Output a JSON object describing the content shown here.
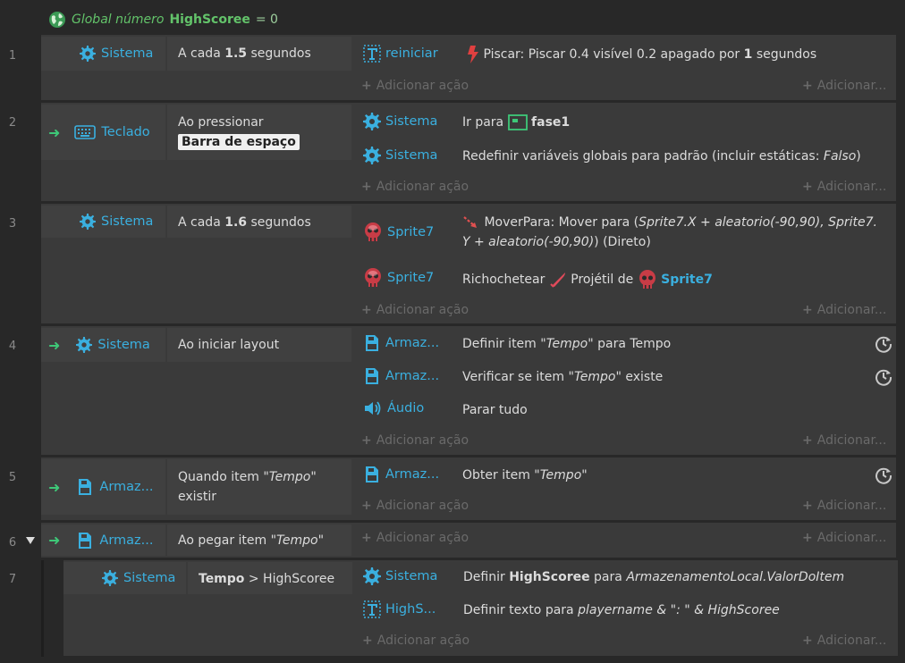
{
  "global_var": {
    "prefix": "Global número",
    "name": "HighScoree",
    "value": "= 0"
  },
  "row_numbers": [
    "1",
    "2",
    "3",
    "4",
    "5",
    "6",
    "7"
  ],
  "events": {
    "e1": {
      "cond_obj": "Sistema",
      "cond_text_a": "A cada",
      "cond_text_b": "1.5",
      "cond_text_c": "segundos",
      "actions": [
        {
          "obj": "reiniciar",
          "text_a": "Piscar: Piscar 0.4 visível 0.2 apagado por",
          "text_b": "1",
          "text_c": "segundos"
        }
      ]
    },
    "e2": {
      "cond_obj": "Teclado",
      "cond_text_a": "Ao pressionar",
      "cond_chip": "Barra de espaço",
      "actions": [
        {
          "obj": "Sistema",
          "text_a": "Ir para",
          "text_b": "fase1"
        },
        {
          "obj": "Sistema",
          "text_a": "Redefinir variáveis globais para padrão (incluir estáticas:",
          "text_b": "Falso",
          "text_c": ")"
        }
      ]
    },
    "e3": {
      "cond_obj": "Sistema",
      "cond_text_a": "A cada",
      "cond_text_b": "1.6",
      "cond_text_c": "segundos",
      "actions": [
        {
          "obj": "Sprite7",
          "text_a": "MoverPara: Mover para (",
          "text_b": "Sprite7.X + aleatorio(-90,90), Sprite7.",
          "text_c": "Y + aleatorio(-90,90)",
          "text_d": ") (Direto)"
        },
        {
          "obj": "Sprite7",
          "text_a": "Richochetear",
          "text_b": "Projétil de",
          "text_c": "Sprite7"
        }
      ]
    },
    "e4": {
      "cond_obj": "Sistema",
      "cond_text_a": "Ao iniciar layout",
      "actions": [
        {
          "obj": "Armaz...",
          "text_a": "Definir item \"",
          "text_b": "Tempo",
          "text_c": "\" para Tempo"
        },
        {
          "obj": "Armaz...",
          "text_a": "Verificar se item \"",
          "text_b": "Tempo",
          "text_c": "\" existe"
        },
        {
          "obj": "Áudio",
          "text_a": "Parar tudo"
        }
      ]
    },
    "e5": {
      "cond_obj": "Armaz...",
      "cond_text_a": "Quando item \"",
      "cond_text_b": "Tempo",
      "cond_text_c": "\"",
      "cond_text_d": "existir",
      "actions": [
        {
          "obj": "Armaz...",
          "text_a": "Obter item \"",
          "text_b": "Tempo",
          "text_c": "\""
        }
      ]
    },
    "e6": {
      "cond_obj": "Armaz...",
      "cond_text_a": "Ao pegar item \"",
      "cond_text_b": "Tempo",
      "cond_text_c": "\""
    },
    "e7": {
      "cond_obj": "Sistema",
      "cond_text_a": "Tempo",
      "cond_text_b": "> HighScoree",
      "actions": [
        {
          "obj": "Sistema",
          "text_a": "Definir",
          "text_b": "HighScoree",
          "text_c": "para",
          "text_d": "ArmazenamentoLocal.ValorDoItem"
        },
        {
          "obj": "HighS...",
          "text_a": "Definir texto para",
          "text_b": "playername & \": \" & HighScoree"
        }
      ]
    }
  },
  "add_action_label": "Adicionar ação",
  "add_right_label": "Adicionar...",
  "colors": {
    "background": "#282828",
    "event_block": "#3a3a3a",
    "condition_bg": "#404040",
    "object_name": "#3ab0e0",
    "global_var": "#63c36a",
    "trigger_arrow": "#3ec878"
  },
  "icons": {
    "globe": "globe-icon",
    "system": "gear-icon",
    "keyboard": "keyboard-icon",
    "text_object": "text-object-icon",
    "flash": "flash-icon",
    "layout": "layout-icon",
    "sprite": "skull-sprite-icon",
    "move_to": "move-arrow-icon",
    "bullet": "bullet-icon",
    "storage": "storage-icon",
    "audio": "speaker-icon",
    "async": "clock-icon",
    "collapse": "collapse-triangle-icon"
  }
}
